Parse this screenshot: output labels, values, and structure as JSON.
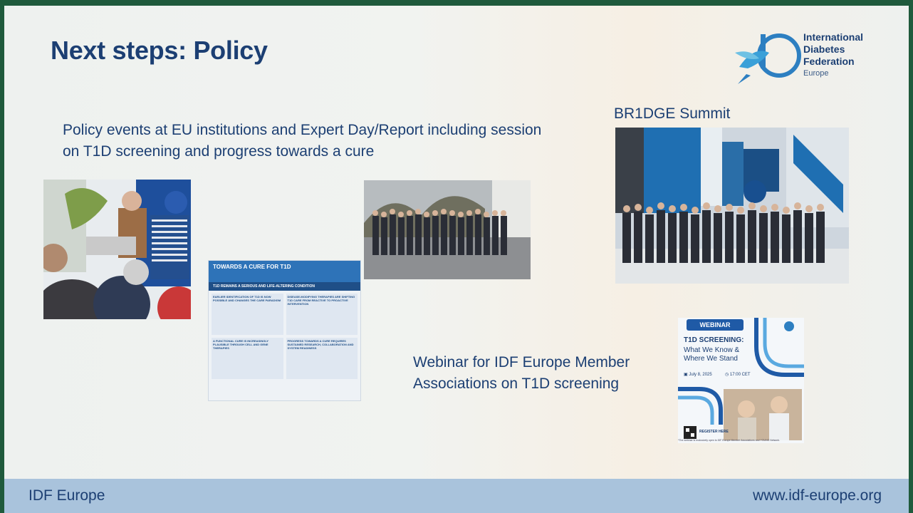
{
  "slide": {
    "title": "Next steps: Policy",
    "lead_text": "Policy events at EU institutions and Expert Day/Report including session on T1D screening and progress towards a cure",
    "bridge_label": "BR1DGE Summit",
    "webinar_label": "Webinar for IDF Europe Member Associations on T1D screening"
  },
  "logo": {
    "line1": "International",
    "line2": "Diabetes",
    "line3": "Federation",
    "region": "Europe"
  },
  "poster": {
    "heading": "TOWARDS A CURE FOR T1D",
    "subheading": "T1D REMAINS A SERIOUS AND LIFE-ALTERING CONDITION",
    "cells": [
      "EARLIER IDENTIFICATION OF T1D IS NOW POSSIBLE AND CHANGES THE CARE PARADIGM",
      "DISEASE-MODIFYING THERAPIES ARE SHIFTING T1D CARE FROM REACTIVE TO PROACTIVE INTERVENTION",
      "A FUNCTIONAL CURE IS INCREASINGLY PLAUSIBLE THROUGH CELL AND GENE THERAPIES",
      "PROGRESS TOWARDS A CURE REQUIRES SUSTAINED RESEARCH, COLLABORATION AND SYSTEM READINESS"
    ]
  },
  "webinar_card": {
    "pill": "WEBINAR",
    "title": "T1D SCREENING:",
    "subtitle_line1": "What We Know &",
    "subtitle_line2": "Where We Stand",
    "date": "July 8, 2025",
    "time": "17:00 CET",
    "register": "REGISTER HERE",
    "note": "*The webinar is exclusively open to IDF Europe Member Associations and YOUNG Network."
  },
  "footer": {
    "left": "IDF Europe",
    "right": "www.idf-europe.org"
  },
  "colors": {
    "navy": "#1c3f73",
    "footer_bg": "#a9c3dc",
    "accent_blue": "#2e73b8"
  }
}
